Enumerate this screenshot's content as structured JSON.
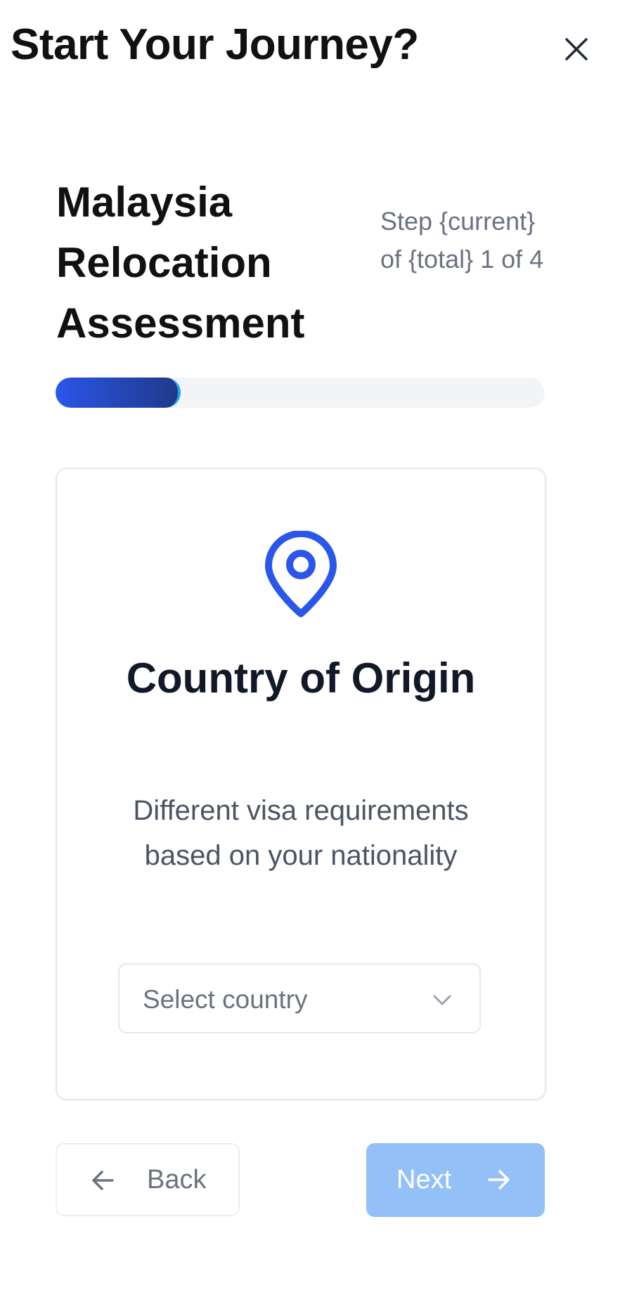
{
  "header": {
    "title": "Start Your Journey?",
    "close_icon": "close-icon"
  },
  "assessment": {
    "title": "Malaysia Relocation Assessment",
    "step_text": "Step {current} of {total} 1 of 4",
    "progress": {
      "current": 1,
      "total": 4,
      "fraction": 0.25
    }
  },
  "card": {
    "icon": "map-pin-icon",
    "title": "Country of Origin",
    "description": "Different visa requirements based on your nationality",
    "select": {
      "placeholder": "Select country",
      "icon": "chevron-down-icon"
    }
  },
  "nav": {
    "back_label": "Back",
    "back_icon": "arrow-left-icon",
    "next_label": "Next",
    "next_icon": "arrow-right-icon"
  },
  "colors": {
    "accent": "#2a56ea",
    "next_button_disabled": "#93c0f7",
    "text_primary": "#111827",
    "text_muted": "#6b7280"
  }
}
